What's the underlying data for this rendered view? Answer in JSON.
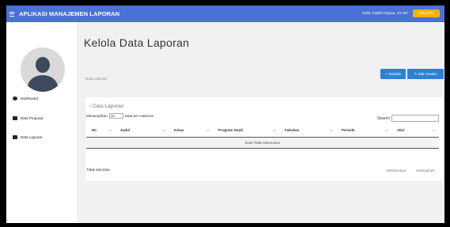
{
  "topbar": {
    "app_title": "APLIKASI MANAJEMEN LAPORAN",
    "greeting": "Hello, Fadhli Fauzan, ST, MT",
    "logout_label": "KELUAR",
    "accent_color": "#4a72d6",
    "logout_color": "#f6b10f"
  },
  "sidebar": {
    "items": [
      {
        "label": "Dashboard",
        "icon": "dashboard-icon"
      },
      {
        "label": "Data Proposal",
        "icon": "book-icon"
      },
      {
        "label": "Data Laporan",
        "icon": "book-icon"
      }
    ]
  },
  "main": {
    "page_title": "Kelola Data Laporan",
    "breadcrumb": "Data Laporan",
    "add_button": "+ Tambah",
    "edit_header_button": "✎ Edit Header",
    "card_title": "› Data Laporan",
    "length": {
      "prefix": "Menampilkan",
      "value": "10",
      "suffix": "Data per Halaman"
    },
    "search_label": "Search:",
    "table": {
      "columns": [
        "No",
        "Judul",
        "Ketua",
        "Program Studi",
        "Fakultas",
        "Periode",
        "Aksi"
      ],
      "empty_message": "Data Tidak Ditemukan"
    },
    "info": "Tidak ada data",
    "pagination": {
      "prev": "Sebelumnya",
      "next": "Selanjutnya"
    }
  }
}
